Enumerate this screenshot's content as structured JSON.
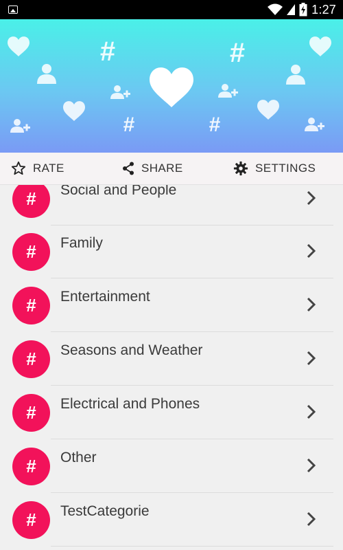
{
  "status_bar": {
    "time": "1:27"
  },
  "toolbar": {
    "rate_label": "RATE",
    "share_label": "SHARE",
    "settings_label": "SETTINGS"
  },
  "categories": [
    {
      "label": "Social and People",
      "badge": "#"
    },
    {
      "label": "Family",
      "badge": "#"
    },
    {
      "label": "Entertainment",
      "badge": "#"
    },
    {
      "label": "Seasons and Weather",
      "badge": "#"
    },
    {
      "label": "Electrical and Phones",
      "badge": "#"
    },
    {
      "label": "Other",
      "badge": "#"
    },
    {
      "label": "TestCategorie",
      "badge": "#"
    }
  ],
  "colors": {
    "badge": "#f2125a",
    "banner_top": "#4af0e8",
    "banner_bottom": "#7a9af5"
  }
}
